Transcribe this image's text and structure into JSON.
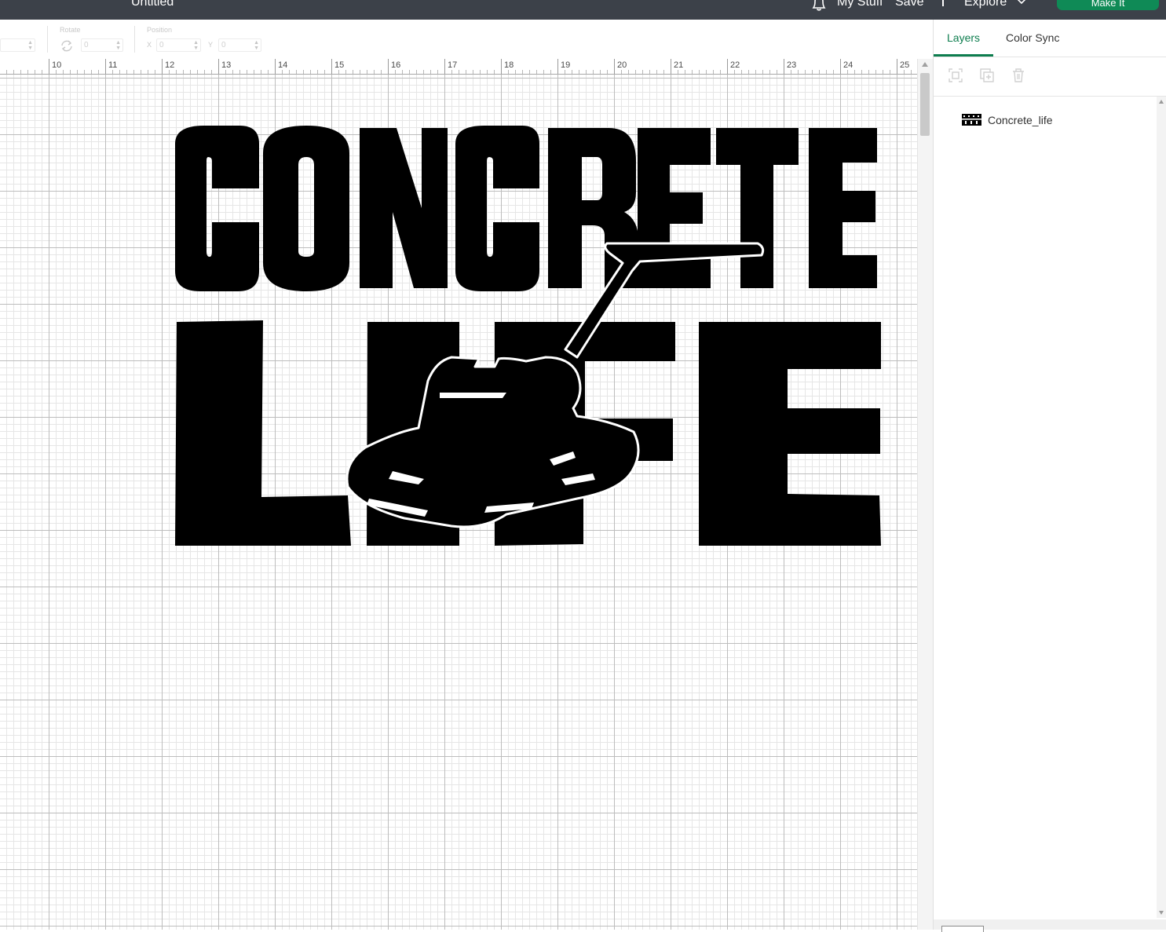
{
  "header": {
    "doc_title": "Untitled",
    "notifications_icon": "bell-icon",
    "my_stuff": "My Stuff",
    "save": "Save",
    "separator": "|",
    "explore": "Explore",
    "explore_icon": "chevron-down-icon",
    "make_it": "Make It",
    "accent_color": "#0f8a56"
  },
  "toolbar": {
    "rotate_label": "Rotate",
    "rotate_value": "0",
    "position_label": "Position",
    "x_label": "X",
    "x_value": "0",
    "y_label": "Y",
    "y_value": "0"
  },
  "canvas": {
    "ruler_ticks": [
      "10",
      "11",
      "12",
      "13",
      "14",
      "15",
      "16",
      "17",
      "18",
      "19",
      "20",
      "21",
      "22",
      "23",
      "24",
      "25"
    ]
  },
  "panel": {
    "tabs": [
      {
        "label": "Layers",
        "active": true
      },
      {
        "label": "Color Sync",
        "active": false
      }
    ],
    "actions": [
      "group-icon",
      "duplicate-icon",
      "delete-icon"
    ],
    "layers": [
      {
        "name": "Concrete_life"
      }
    ],
    "active_color": "#0d7d4e"
  }
}
